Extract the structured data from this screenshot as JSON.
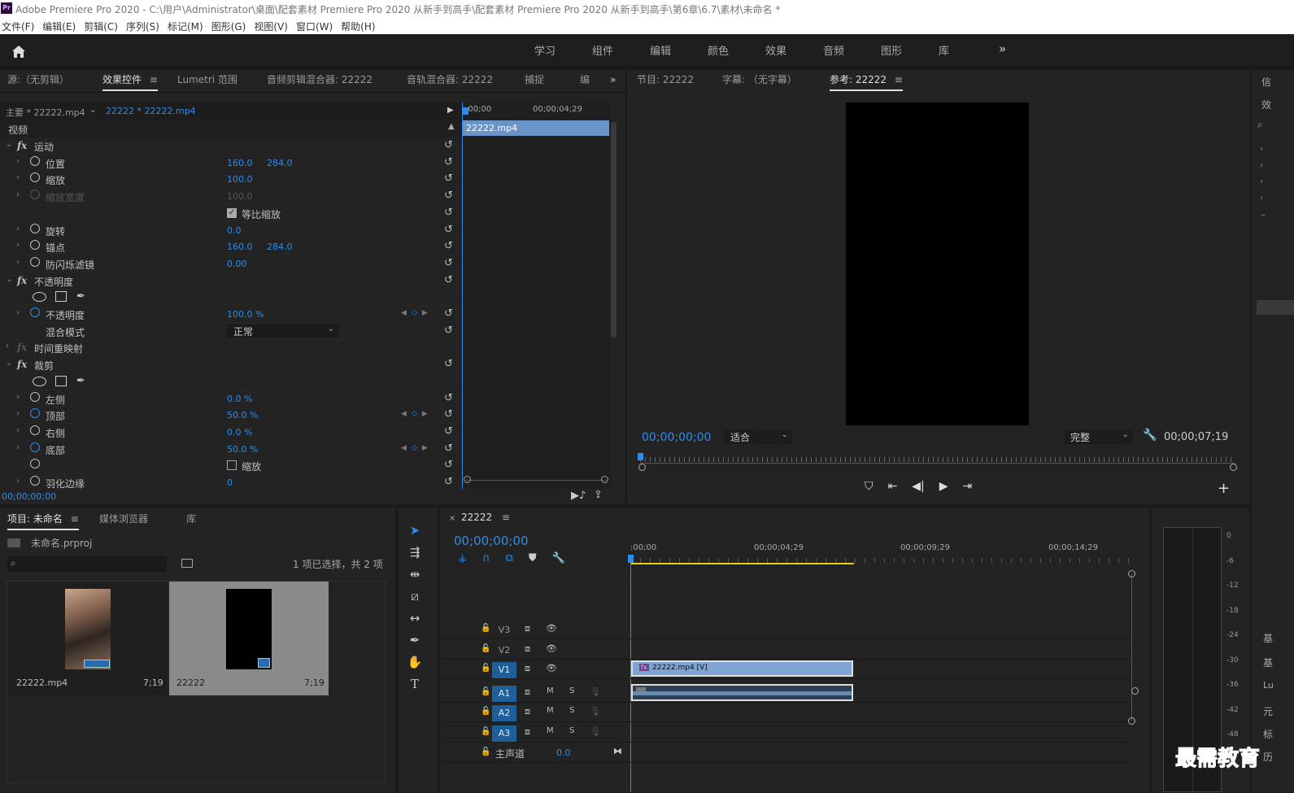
{
  "titlebar": {
    "app_icon": "Pr",
    "title": "Adobe Premiere Pro 2020 - C:\\用户\\Administrator\\桌面\\配套素材 Premiere Pro 2020 从新手到高手\\配套素材 Premiere Pro 2020 从新手到高手\\第6章\\6.7\\素材\\未命名 *"
  },
  "menubar": [
    "文件(F)",
    "编辑(E)",
    "剪辑(C)",
    "序列(S)",
    "标记(M)",
    "图形(G)",
    "视图(V)",
    "窗口(W)",
    "帮助(H)"
  ],
  "workspaces": [
    "学习",
    "组件",
    "编辑",
    "颜色",
    "效果",
    "音频",
    "图形",
    "库"
  ],
  "workspace_more": "»",
  "source_panel": {
    "tabs": [
      "源:（无剪辑）",
      "效果控件",
      "Lumetri 范围",
      "音频剪辑混合器: 22222",
      "音轨混合器: 22222",
      "捕捉",
      "编"
    ],
    "active_tab": 1,
    "more": "»",
    "master_clip": "主要 * 22222.mp4",
    "sequence_clip": "22222 * 22222.mp4",
    "mini_timeline": {
      "start": ":00;00",
      "mid": "00;00;04;29",
      "clip": "22222.mp4"
    },
    "section_video": "视频",
    "timecode": "00;00;00;00",
    "effects": [
      {
        "type": "group",
        "name": "运动"
      },
      {
        "type": "prop",
        "name": "位置",
        "v1": "160.0",
        "v2": "284.0"
      },
      {
        "type": "prop",
        "name": "缩放",
        "v1": "100.0"
      },
      {
        "type": "prop",
        "name": "缩放宽度",
        "v1": "100.0",
        "disabled": true
      },
      {
        "type": "check",
        "name": "等比缩放",
        "checked": true
      },
      {
        "type": "prop",
        "name": "旋转",
        "v1": "0.0"
      },
      {
        "type": "prop",
        "name": "锚点",
        "v1": "160.0",
        "v2": "284.0"
      },
      {
        "type": "prop",
        "name": "防闪烁滤镜",
        "v1": "0.00"
      },
      {
        "type": "group",
        "name": "不透明度"
      },
      {
        "type": "masks"
      },
      {
        "type": "prop",
        "name": "不透明度",
        "v1": "100.0 %",
        "animated": true
      },
      {
        "type": "select",
        "name": "混合模式",
        "value": "正常"
      },
      {
        "type": "group",
        "name": "时间重映射",
        "collapsed": true
      },
      {
        "type": "group",
        "name": "裁剪"
      },
      {
        "type": "masks"
      },
      {
        "type": "prop",
        "name": "左侧",
        "v1": "0.0 %"
      },
      {
        "type": "prop",
        "name": "顶部",
        "v1": "50.0 %",
        "animated": true
      },
      {
        "type": "prop",
        "name": "右侧",
        "v1": "0.0 %"
      },
      {
        "type": "prop",
        "name": "底部",
        "v1": "50.0 %",
        "animated": true
      },
      {
        "type": "check",
        "name": "缩放",
        "checked": false
      },
      {
        "type": "prop",
        "name": "羽化边缘",
        "v1": "0"
      }
    ]
  },
  "program_panel": {
    "tabs": [
      "节目: 22222",
      "字幕: （无字幕）",
      "参考: 22222"
    ],
    "active_tab": 2,
    "timecode": "00;00;00;00",
    "fit": "适合",
    "quality": "完整",
    "duration": "00;00;07;19",
    "add": "+"
  },
  "project_panel": {
    "tabs": [
      "项目: 未命名",
      "媒体浏览器",
      "库"
    ],
    "active_tab": 0,
    "file": "未命名.prproj",
    "search_placeholder": "",
    "selection_info": "1 项已选择，共 2 项",
    "items": [
      {
        "name": "22222.mp4",
        "duration": "7;19"
      },
      {
        "name": "22222",
        "duration": "7;19"
      }
    ]
  },
  "timeline": {
    "sequence": "22222",
    "timecode": "00;00;00;00",
    "ruler": [
      ":00;00",
      "00;00;04;29",
      "00;00;09;29",
      "00;00;14;29"
    ],
    "video_tracks": [
      "V3",
      "V2",
      "V1"
    ],
    "audio_tracks": [
      "A1",
      "A2",
      "A3"
    ],
    "master": "主声道",
    "master_value": "0.0",
    "video_clip": "22222.mp4 [V]",
    "m": "M",
    "s": "S"
  },
  "meter": {
    "labels": [
      "0",
      "-6",
      "-12",
      "-18",
      "-24",
      "-30",
      "-36",
      "-42",
      "-48"
    ]
  },
  "right_strip": [
    "信",
    "效",
    "基",
    "基",
    "Lu",
    "元",
    "标",
    "历"
  ],
  "watermark": "最需教育"
}
